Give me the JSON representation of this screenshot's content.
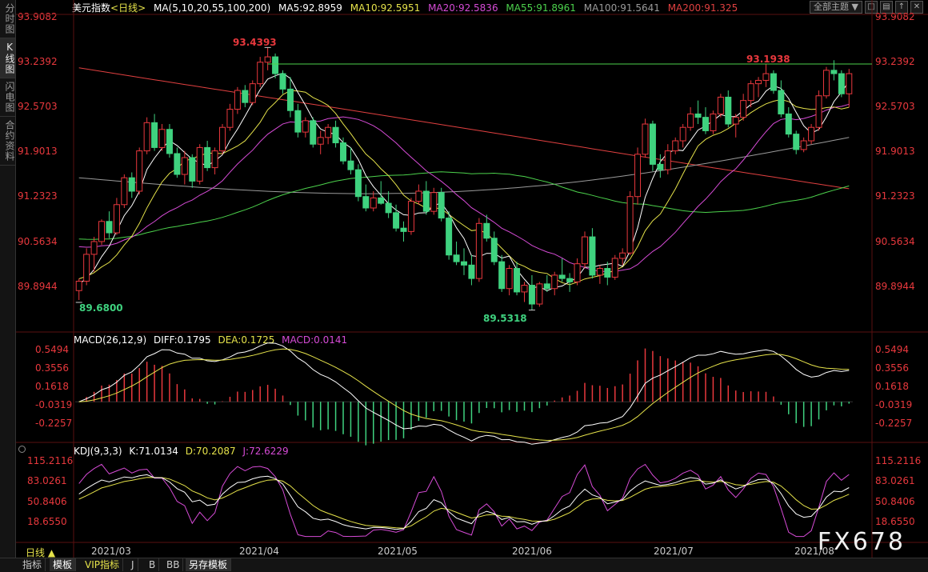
{
  "sidebar": {
    "tabs": [
      {
        "label": "分时图",
        "active": false
      },
      {
        "label": "K线图",
        "active": true
      },
      {
        "label": "闪电图",
        "active": false
      },
      {
        "label": "合约资料",
        "active": false
      }
    ]
  },
  "legend": {
    "symbol": "美元指数",
    "period": "<日线>",
    "ma_header": "MA(5,10,20,55,100,200)",
    "ma5": "MA5:92.8959",
    "ma10": "MA10:92.5951",
    "ma20": "MA20:92.5836",
    "ma55": "MA55:91.8961",
    "ma100": "MA100:91.5641",
    "ma200": "MA200:91.325"
  },
  "toolbar": {
    "theme_select": "全部主题 ▼",
    "btn1": "□",
    "btn2": "▤",
    "btn3": "↑",
    "btn4": "✕"
  },
  "price_axis": [
    "93.9082",
    "93.2392",
    "92.5703",
    "91.9013",
    "91.2323",
    "90.5634",
    "89.8944"
  ],
  "annotations": {
    "high1": "93.4393",
    "high2": "93.1938",
    "low1": "89.6800",
    "low2": "89.5318"
  },
  "macd": {
    "header": "MACD(26,12,9)",
    "diff": "DIFF:0.1795",
    "dea": "DEA:0.1725",
    "macd": "MACD:0.0141",
    "axis": [
      "0.5494",
      "0.3556",
      "0.1618",
      "-0.0319",
      "-0.2257"
    ]
  },
  "kdj": {
    "header": "KDJ(9,3,3)",
    "k": "K:71.0134",
    "d": "D:70.2087",
    "j": "J:72.6229",
    "axis": [
      "115.2116",
      "83.0261",
      "50.8406",
      "18.6550"
    ]
  },
  "xaxis": [
    "2021/03",
    "2021/04",
    "2021/05",
    "2021/06",
    "2021/07",
    "2021/08"
  ],
  "bottom": {
    "period": "日线 ▲",
    "tabs": [
      "指标",
      "模板",
      "VIP指标",
      "J",
      "B",
      "BB",
      "另存模板"
    ]
  },
  "watermark": "FX678",
  "colors": {
    "up": "#e8383d",
    "down": "#3fd27f",
    "ma5": "#ffffff",
    "ma10": "#e5e24a",
    "ma20": "#d64bd6",
    "ma55": "#4cd24c",
    "ma100": "#9a9a9a",
    "ma200": "#e04040"
  },
  "chart_data": {
    "type": "candlestick",
    "title": "美元指数 <日线>",
    "ylim": [
      89.5,
      93.9
    ],
    "x_ticks": [
      "2021/03",
      "2021/04",
      "2021/05",
      "2021/06",
      "2021/07",
      "2021/08"
    ],
    "ohlc": [
      [
        89.82,
        90.0,
        89.68,
        89.96
      ],
      [
        89.96,
        90.45,
        89.9,
        90.36
      ],
      [
        90.36,
        90.62,
        90.1,
        90.55
      ],
      [
        90.55,
        90.88,
        90.5,
        90.85
      ],
      [
        90.85,
        91.0,
        90.6,
        90.68
      ],
      [
        90.68,
        91.2,
        90.65,
        91.1
      ],
      [
        91.1,
        91.55,
        91.05,
        91.5
      ],
      [
        91.5,
        91.58,
        91.2,
        91.3
      ],
      [
        91.3,
        91.95,
        91.25,
        91.9
      ],
      [
        91.9,
        92.4,
        91.85,
        92.32
      ],
      [
        92.32,
        92.45,
        91.9,
        91.95
      ],
      [
        91.95,
        92.3,
        91.9,
        92.22
      ],
      [
        92.22,
        92.3,
        91.8,
        91.86
      ],
      [
        91.86,
        91.95,
        91.5,
        91.55
      ],
      [
        91.55,
        91.9,
        91.4,
        91.8
      ],
      [
        91.8,
        91.85,
        91.35,
        91.45
      ],
      [
        91.45,
        92.0,
        91.4,
        91.95
      ],
      [
        91.95,
        92.05,
        91.6,
        91.65
      ],
      [
        91.65,
        91.95,
        91.55,
        91.9
      ],
      [
        91.9,
        92.3,
        91.85,
        92.25
      ],
      [
        92.25,
        92.6,
        92.2,
        92.52
      ],
      [
        92.52,
        92.85,
        92.45,
        92.8
      ],
      [
        92.8,
        92.88,
        92.55,
        92.62
      ],
      [
        92.62,
        92.95,
        92.58,
        92.9
      ],
      [
        92.9,
        93.3,
        92.85,
        93.22
      ],
      [
        93.22,
        93.44,
        93.1,
        93.3
      ],
      [
        93.3,
        93.35,
        92.98,
        93.05
      ],
      [
        93.05,
        93.1,
        92.75,
        92.82
      ],
      [
        92.82,
        93.0,
        92.4,
        92.5
      ],
      [
        92.5,
        92.6,
        92.1,
        92.18
      ],
      [
        92.18,
        92.4,
        92.1,
        92.35
      ],
      [
        92.35,
        92.4,
        91.95,
        92.0
      ],
      [
        92.0,
        92.2,
        91.85,
        92.1
      ],
      [
        92.1,
        92.3,
        92.0,
        92.25
      ],
      [
        92.25,
        92.35,
        91.95,
        92.02
      ],
      [
        92.02,
        92.1,
        91.7,
        91.75
      ],
      [
        91.75,
        91.95,
        91.55,
        91.62
      ],
      [
        91.62,
        91.7,
        91.15,
        91.22
      ],
      [
        91.22,
        91.4,
        91.0,
        91.05
      ],
      [
        91.05,
        91.3,
        91.0,
        91.2
      ],
      [
        91.2,
        91.45,
        91.1,
        91.12
      ],
      [
        91.12,
        91.3,
        90.9,
        90.98
      ],
      [
        90.98,
        91.1,
        90.7,
        90.75
      ],
      [
        90.75,
        90.85,
        90.55,
        90.7
      ],
      [
        90.7,
        91.2,
        90.65,
        91.15
      ],
      [
        91.15,
        91.4,
        91.1,
        91.3
      ],
      [
        91.3,
        91.45,
        90.95,
        91.0
      ],
      [
        91.0,
        91.35,
        90.95,
        91.28
      ],
      [
        91.28,
        91.35,
        90.85,
        90.9
      ],
      [
        90.9,
        91.0,
        90.28,
        90.35
      ],
      [
        90.35,
        90.55,
        90.2,
        90.25
      ],
      [
        90.25,
        90.45,
        90.05,
        90.2
      ],
      [
        90.2,
        90.35,
        89.9,
        90.0
      ],
      [
        90.0,
        90.9,
        89.95,
        90.82
      ],
      [
        90.82,
        90.95,
        90.55,
        90.6
      ],
      [
        90.6,
        90.7,
        90.2,
        90.25
      ],
      [
        90.25,
        90.35,
        89.8,
        89.85
      ],
      [
        89.85,
        90.2,
        89.75,
        90.15
      ],
      [
        90.15,
        90.25,
        89.75,
        89.8
      ],
      [
        89.8,
        89.95,
        89.65,
        89.9
      ],
      [
        89.9,
        90.05,
        89.53,
        89.62
      ],
      [
        89.62,
        89.95,
        89.58,
        89.92
      ],
      [
        89.92,
        90.05,
        89.8,
        89.85
      ],
      [
        89.85,
        90.1,
        89.75,
        90.05
      ],
      [
        90.05,
        90.3,
        89.95,
        90.0
      ],
      [
        90.0,
        90.08,
        89.8,
        89.95
      ],
      [
        89.95,
        90.3,
        89.9,
        90.22
      ],
      [
        90.22,
        90.7,
        90.15,
        90.62
      ],
      [
        90.62,
        90.75,
        90.0,
        90.05
      ],
      [
        90.05,
        90.2,
        89.92,
        90.15
      ],
      [
        90.15,
        90.25,
        89.9,
        90.02
      ],
      [
        90.02,
        90.35,
        89.98,
        90.3
      ],
      [
        90.3,
        90.45,
        90.2,
        90.38
      ],
      [
        90.38,
        91.3,
        90.35,
        91.22
      ],
      [
        91.22,
        91.95,
        91.1,
        91.85
      ],
      [
        91.85,
        92.38,
        91.8,
        92.3
      ],
      [
        92.3,
        92.35,
        91.6,
        91.7
      ],
      [
        91.7,
        91.85,
        91.5,
        91.62
      ],
      [
        91.62,
        92.0,
        91.55,
        91.9
      ],
      [
        91.9,
        92.1,
        91.85,
        92.05
      ],
      [
        92.05,
        92.3,
        91.95,
        92.25
      ],
      [
        92.25,
        92.55,
        92.2,
        92.45
      ],
      [
        92.45,
        92.65,
        92.3,
        92.4
      ],
      [
        92.4,
        92.55,
        92.15,
        92.2
      ],
      [
        92.2,
        92.5,
        92.15,
        92.45
      ],
      [
        92.45,
        92.75,
        92.4,
        92.7
      ],
      [
        92.7,
        92.8,
        92.25,
        92.3
      ],
      [
        92.3,
        92.45,
        92.1,
        92.4
      ],
      [
        92.4,
        92.75,
        92.35,
        92.65
      ],
      [
        92.65,
        92.95,
        92.55,
        92.9
      ],
      [
        92.9,
        93.0,
        92.7,
        92.95
      ],
      [
        92.95,
        93.19,
        92.85,
        93.05
      ],
      [
        93.05,
        93.1,
        92.75,
        92.8
      ],
      [
        92.8,
        92.95,
        92.4,
        92.45
      ],
      [
        92.45,
        92.55,
        92.1,
        92.15
      ],
      [
        92.15,
        92.2,
        91.85,
        91.92
      ],
      [
        91.92,
        92.1,
        91.88,
        92.05
      ],
      [
        92.05,
        92.3,
        92.0,
        92.25
      ],
      [
        92.25,
        92.8,
        92.2,
        92.72
      ],
      [
        92.72,
        93.15,
        92.68,
        93.1
      ],
      [
        93.1,
        93.25,
        92.95,
        93.05
      ],
      [
        93.05,
        93.1,
        92.7,
        92.75
      ],
      [
        92.75,
        93.12,
        92.55,
        93.05
      ]
    ],
    "macd_series": {
      "diff_last": 0.1795,
      "dea_last": 0.1725,
      "macd_last": 0.0141
    },
    "kdj_series": {
      "k_last": 71.0134,
      "d_last": 70.2087,
      "j_last": 72.6229
    }
  }
}
